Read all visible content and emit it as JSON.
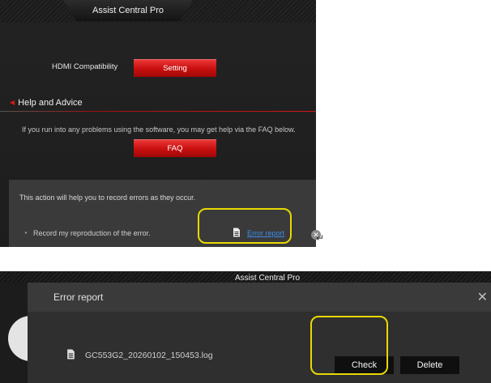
{
  "top": {
    "title": "Assist Central Pro",
    "hdmi_label": "HDMI Compatibility",
    "setting_button": "Setting",
    "help_heading": "Help and Advice",
    "help_text": "If you run into any problems using the software, you may get help via the FAQ below.",
    "faq_button": "FAQ",
    "error_text": "This action will help you to record errors as they occur.",
    "record_text": "Record my reproduction of the error.",
    "error_report_link": "Error report",
    "close_glyph": "✕",
    "return_glyph": "↵"
  },
  "bottom": {
    "title": "Assist Central Pro",
    "dialog_title": "Error report",
    "close_glyph": "✕",
    "log_file": "GC553G2_20260102_150453.log",
    "check_button": "Check",
    "delete_button": "Delete",
    "return_glyph": "↵"
  },
  "colors": {
    "accent_red": "#c80f0f",
    "link_blue": "#3c8ce8",
    "highlight_yellow": "#e8d800"
  },
  "icons": [
    "title-tab",
    "red-triangle-icon",
    "clock-icon",
    "document-icon",
    "close-icon"
  ]
}
